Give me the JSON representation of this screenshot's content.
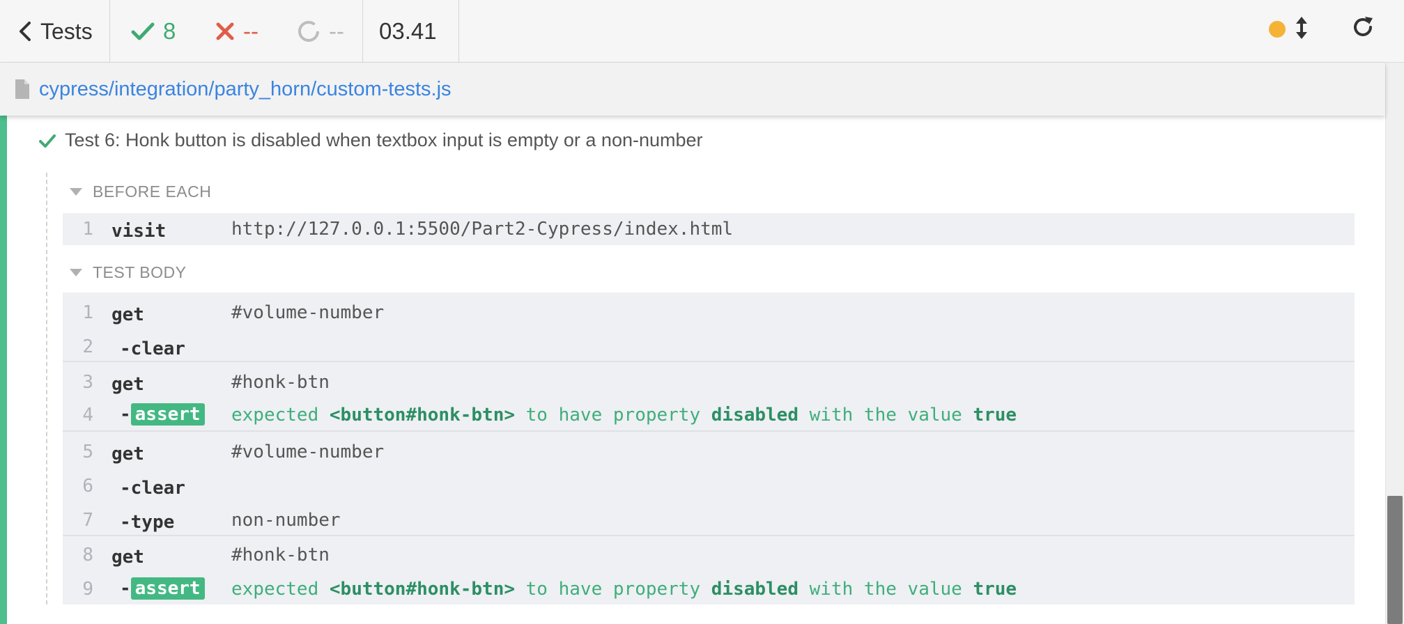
{
  "toolbar": {
    "tests_label": "Tests",
    "passed_count": "8",
    "failed_count": "--",
    "pending_count": "--",
    "duration": "03.41",
    "status_color": "#f5b336",
    "icons": [
      "chevron-left-icon",
      "check-icon",
      "x-icon",
      "spinner-icon",
      "resize-icon",
      "reload-icon"
    ]
  },
  "spec": {
    "path": "cypress/integration/party_horn/custom-tests.js",
    "icon": "file-icon"
  },
  "test": {
    "title": "Test 6: Honk button is disabled when textbox input is empty or a non-number",
    "state": "passed",
    "before_each": {
      "label": "BEFORE EACH",
      "commands": [
        {
          "num": "1",
          "name": "visit",
          "message": "http://127.0.0.1:5500/Part2-Cypress/index.html"
        }
      ]
    },
    "test_body": {
      "label": "TEST BODY",
      "commands": [
        {
          "num": "1",
          "name": "get",
          "message": "#volume-number"
        },
        {
          "num": "2",
          "name": "-clear",
          "message": ""
        },
        {
          "num": "3",
          "name": "get",
          "message": "#honk-btn"
        },
        {
          "num": "4",
          "name": "assert",
          "prefix": "-",
          "message_parts": [
            "expected",
            "<button#honk-btn>",
            "to have property",
            "disabled",
            "with the value",
            "true"
          ]
        },
        {
          "num": "5",
          "name": "get",
          "message": "#volume-number"
        },
        {
          "num": "6",
          "name": "-clear",
          "message": ""
        },
        {
          "num": "7",
          "name": "-type",
          "message": "non-number"
        },
        {
          "num": "8",
          "name": "get",
          "message": "#honk-btn"
        },
        {
          "num": "9",
          "name": "assert",
          "prefix": "-",
          "message_parts": [
            "expected",
            "<button#honk-btn>",
            "to have property",
            "disabled",
            "with the value",
            "true"
          ]
        }
      ]
    }
  },
  "colors": {
    "pass": "#3faa73",
    "fail": "#e05d4a",
    "link": "#3a84e0",
    "assert_badge": "#44b883"
  }
}
